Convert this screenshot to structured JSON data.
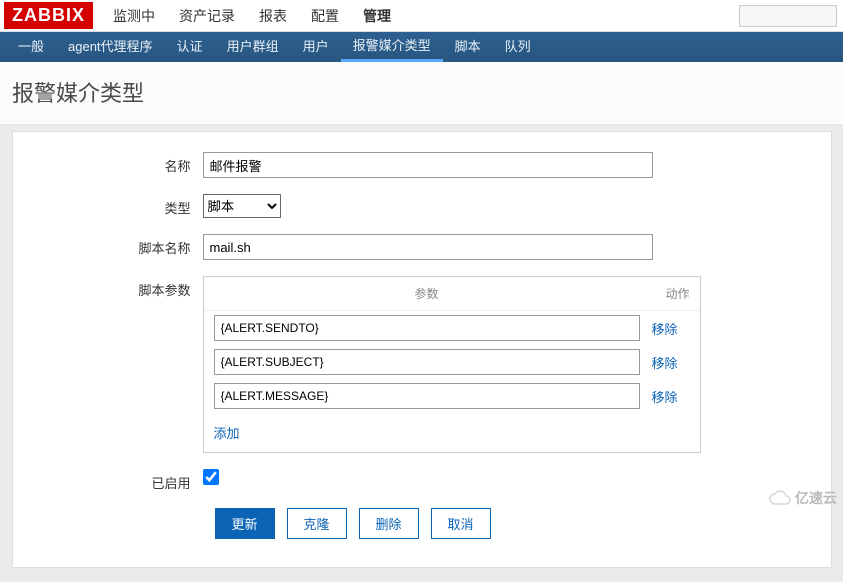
{
  "logo": "ZABBIX",
  "top_menu": [
    "监测中",
    "资产记录",
    "报表",
    "配置",
    "管理"
  ],
  "top_menu_active": 4,
  "sub_menu": [
    "一般",
    "agent代理程序",
    "认证",
    "用户群组",
    "用户",
    "报警媒介类型",
    "脚本",
    "队列"
  ],
  "sub_menu_active": 5,
  "page_title": "报警媒介类型",
  "form": {
    "name_label": "名称",
    "name_value": "邮件报警",
    "type_label": "类型",
    "type_value": "脚本",
    "script_name_label": "脚本名称",
    "script_name_value": "mail.sh",
    "params_label": "脚本参数",
    "params_header_param": "参数",
    "params_header_action": "动作",
    "params": [
      {
        "value": "{ALERT.SENDTO}",
        "remove": "移除"
      },
      {
        "value": "{ALERT.SUBJECT}",
        "remove": "移除"
      },
      {
        "value": "{ALERT.MESSAGE}",
        "remove": "移除"
      }
    ],
    "add_label": "添加",
    "enabled_label": "已启用",
    "enabled_checked": true
  },
  "buttons": {
    "update": "更新",
    "clone": "克隆",
    "delete": "删除",
    "cancel": "取消"
  },
  "watermark": "亿速云"
}
